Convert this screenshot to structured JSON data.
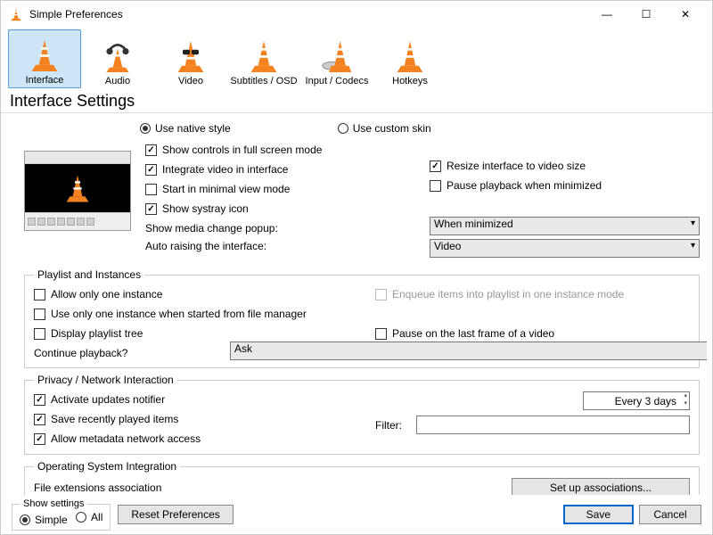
{
  "window": {
    "title": "Simple Preferences",
    "min": "—",
    "max": "☐",
    "close": "✕"
  },
  "categories": [
    {
      "id": "interface",
      "label": "Interface",
      "selected": true
    },
    {
      "id": "audio",
      "label": "Audio",
      "selected": false
    },
    {
      "id": "video",
      "label": "Video",
      "selected": false
    },
    {
      "id": "subtitles",
      "label": "Subtitles / OSD",
      "selected": false
    },
    {
      "id": "input",
      "label": "Input / Codecs",
      "selected": false
    },
    {
      "id": "hotkeys",
      "label": "Hotkeys",
      "selected": false
    }
  ],
  "heading": "Interface Settings",
  "skin": {
    "native": "Use native style",
    "custom": "Use custom skin"
  },
  "main": {
    "show_controls": "Show controls in full screen mode",
    "integrate_video": "Integrate video in interface",
    "start_minimal": "Start in minimal view mode",
    "show_systray": "Show systray icon",
    "resize_interface": "Resize interface to video size",
    "pause_minimized": "Pause playback when minimized",
    "media_popup_label": "Show media change popup:",
    "media_popup_value": "When minimized",
    "auto_raise_label": "Auto raising the interface:",
    "auto_raise_value": "Video"
  },
  "playlist": {
    "legend": "Playlist and Instances",
    "allow_one": "Allow only one instance",
    "enqueue": "Enqueue items into playlist in one instance mode",
    "use_one_fm": "Use only one instance when started from file manager",
    "display_tree": "Display playlist tree",
    "pause_last": "Pause on the last frame of a video",
    "continue_label": "Continue playback?",
    "continue_value": "Ask"
  },
  "privacy": {
    "legend": "Privacy / Network Interaction",
    "updates": "Activate updates notifier",
    "updates_value": "Every 3 days",
    "save_recent": "Save recently played items",
    "filter_label": "Filter:",
    "allow_meta": "Allow metadata network access"
  },
  "os": {
    "legend": "Operating System Integration",
    "file_ext": "File extensions association",
    "setup_btn": "Set up associations..."
  },
  "footer": {
    "show_legend": "Show settings",
    "simple": "Simple",
    "all": "All",
    "reset": "Reset Preferences",
    "save": "Save",
    "cancel": "Cancel"
  }
}
